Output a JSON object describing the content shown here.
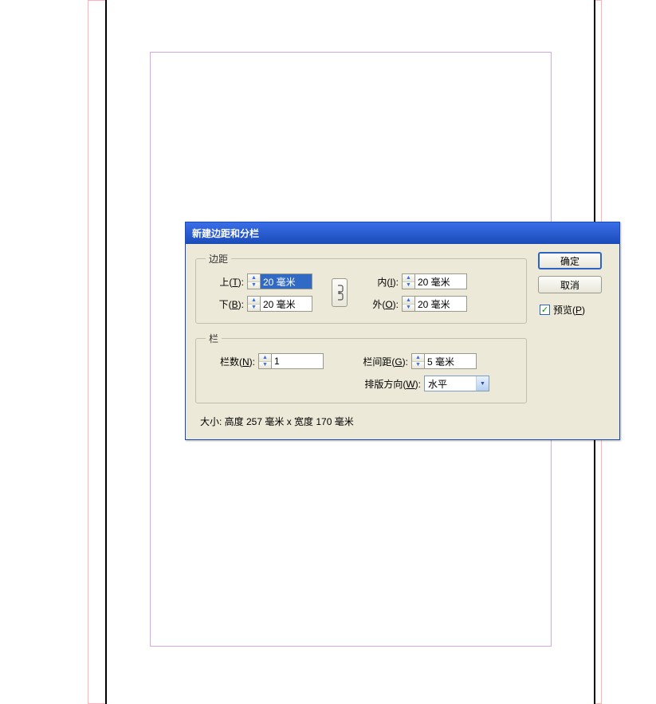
{
  "dialog": {
    "title": "新建边距和分栏",
    "margins": {
      "legend": "边距",
      "top_label": "上(T):",
      "bottom_label": "下(B):",
      "inside_label": "内(I):",
      "outside_label": "外(O):",
      "top_value": "20 毫米",
      "bottom_value": "20 毫米",
      "inside_value": "20 毫米",
      "outside_value": "20 毫米"
    },
    "columns": {
      "legend": "栏",
      "count_label": "栏数(N):",
      "count_value": "1",
      "gutter_label": "栏间距(G):",
      "gutter_value": "5 毫米",
      "direction_label": "排版方向(W):",
      "direction_value": "水平"
    },
    "footer": "大小: 高度 257 毫米 x 宽度 170 毫米",
    "buttons": {
      "ok": "确定",
      "cancel": "取消"
    },
    "preview_label": "预览(P)",
    "preview_checked": true
  }
}
